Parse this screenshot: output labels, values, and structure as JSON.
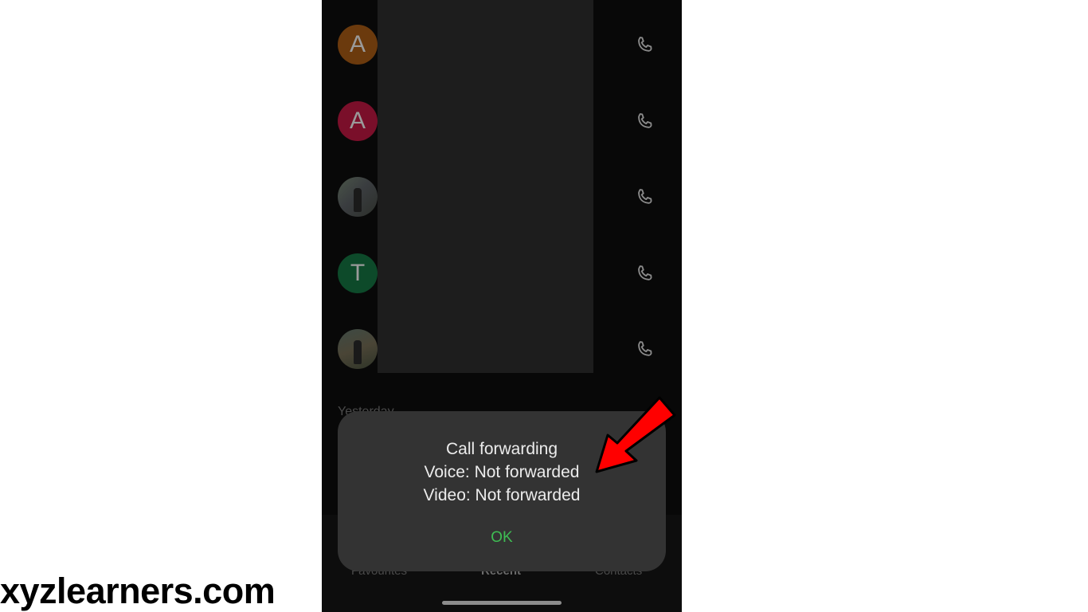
{
  "calls": [
    {
      "avatar_type": "initial",
      "initial": "A",
      "avatar_color": "#6b3a0d"
    },
    {
      "avatar_type": "initial",
      "initial": "A",
      "avatar_color": "#7a0f2a"
    },
    {
      "avatar_type": "photo",
      "initial": "",
      "avatar_color": "#3f4640"
    },
    {
      "avatar_type": "initial",
      "initial": "T",
      "avatar_color": "#0d4a2a"
    },
    {
      "avatar_type": "photo",
      "initial": "",
      "avatar_color": "#474236"
    }
  ],
  "section_label": "Yesterday",
  "dialog": {
    "title": "Call forwarding",
    "voice_line": "Voice: Not forwarded",
    "video_line": "Video: Not forwarded",
    "ok_label": "OK"
  },
  "tabs": [
    {
      "label": "Favourites",
      "active": false
    },
    {
      "label": "Recent",
      "active": true
    },
    {
      "label": "Contacts",
      "active": false
    }
  ],
  "watermark": "xyzlearners.com",
  "colors": {
    "ok_green": "#3ebd53",
    "arrow_red": "#ff0000",
    "dialog_bg": "#333333"
  },
  "icons": {
    "call": "phone-icon",
    "annotation": "red-arrow-icon"
  }
}
